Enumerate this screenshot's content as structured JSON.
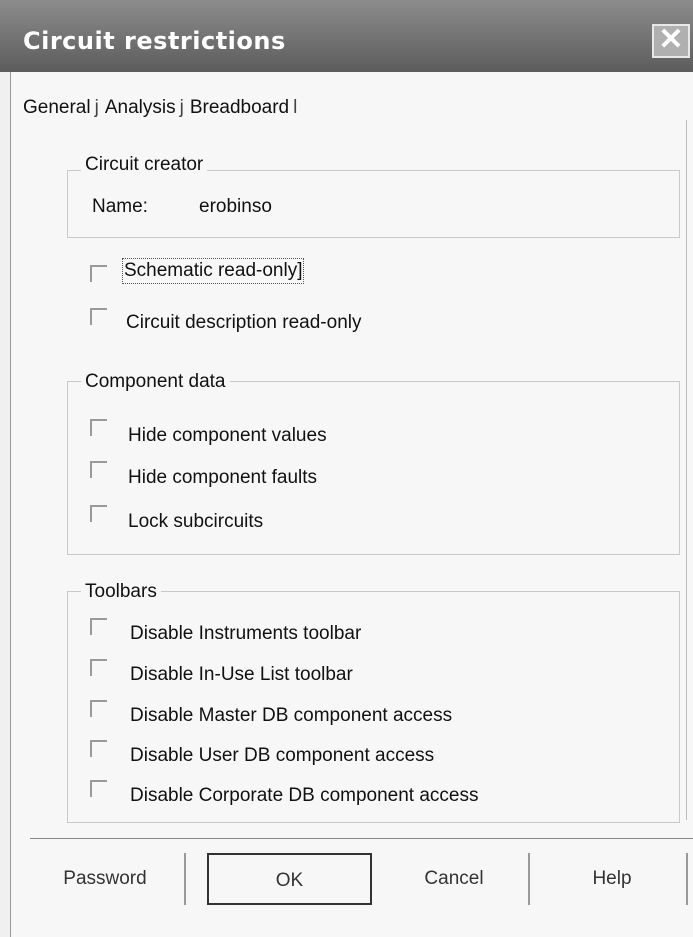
{
  "window": {
    "title": "Circuit restrictions",
    "close_glyph": "✕"
  },
  "tabs": [
    {
      "label": "General",
      "sep": "j"
    },
    {
      "label": "Analysis",
      "sep": "j"
    },
    {
      "label": "Breadboard",
      "sep": "l"
    }
  ],
  "circuit_creator": {
    "legend": "Circuit creator",
    "name_label": "Name:",
    "name_value": "erobinso"
  },
  "readonly_options": [
    {
      "label": "Schematic read-only]",
      "checked": false
    },
    {
      "label": "Circuit description read-only",
      "checked": false
    }
  ],
  "component_data": {
    "legend": "Component data",
    "options": [
      {
        "label": "Hide component values",
        "checked": false
      },
      {
        "label": "Hide component faults",
        "checked": false
      },
      {
        "label": "Lock subcircuits",
        "checked": false
      }
    ]
  },
  "toolbars": {
    "legend": "Toolbars",
    "options": [
      {
        "label": "Disable Instruments toolbar",
        "checked": false
      },
      {
        "label": "Disable In-Use List toolbar",
        "checked": false
      },
      {
        "label": "Disable Master DB component access",
        "checked": false
      },
      {
        "label": "Disable User DB component access",
        "checked": false
      },
      {
        "label": "Disable Corporate DB component access",
        "checked": false
      }
    ]
  },
  "buttons": {
    "password": "Password",
    "ok": "OK",
    "cancel": "Cancel",
    "help": "Help"
  }
}
